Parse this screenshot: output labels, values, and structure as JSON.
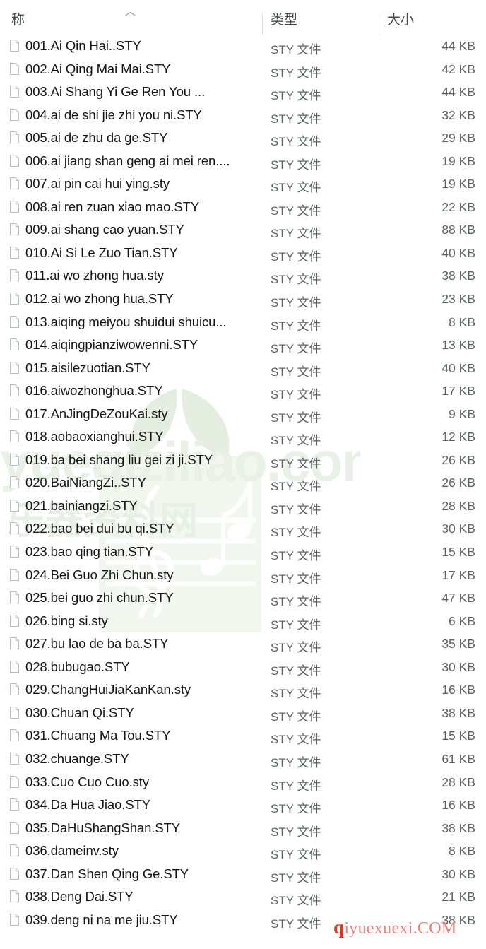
{
  "watermarks": {
    "green_text": "yueqiziliao.com",
    "green_subtext": "乐器资料网",
    "red_text": "qiyuexuexi.COM",
    "red_first_letter": "q",
    "red_rest": "iyuexuexi.COM",
    "red_color": "#d93b2b",
    "green_color": "#dfe9dc"
  },
  "columns": {
    "sort_indicator": "︿",
    "name_label": "名称",
    "name_label_clipped": "称",
    "type_label": "类型",
    "size_label": "大小"
  },
  "icon": {
    "file": "file-icon"
  },
  "files": [
    {
      "name": "001.Ai  Qin  Hai..STY",
      "type": "STY 文件",
      "size": "44 KB"
    },
    {
      "name": "002.Ai  Qing  Mai  Mai.STY",
      "type": "STY 文件",
      "size": "42 KB"
    },
    {
      "name": "003.Ai  Shang  Yi  Ge  Ren  You  ...",
      "type": "STY 文件",
      "size": "44 KB"
    },
    {
      "name": "004.ai de shi jie zhi you ni.STY",
      "type": "STY 文件",
      "size": "32 KB"
    },
    {
      "name": "005.ai de zhu da ge.STY",
      "type": "STY 文件",
      "size": "29 KB"
    },
    {
      "name": "006.ai jiang shan geng ai mei ren....",
      "type": "STY 文件",
      "size": "19 KB"
    },
    {
      "name": "007.ai pin cai hui ying.sty",
      "type": "STY 文件",
      "size": "19 KB"
    },
    {
      "name": "008.ai ren zuan xiao mao.STY",
      "type": "STY 文件",
      "size": "22 KB"
    },
    {
      "name": "009.ai shang cao yuan.STY",
      "type": "STY 文件",
      "size": "88 KB"
    },
    {
      "name": "010.Ai Si Le Zuo Tian.STY",
      "type": "STY 文件",
      "size": "40 KB"
    },
    {
      "name": "011.ai wo zhong hua.sty",
      "type": "STY 文件",
      "size": "38 KB"
    },
    {
      "name": "012.ai wo zhong hua.STY",
      "type": "STY 文件",
      "size": "23 KB"
    },
    {
      "name": "013.aiqing meiyou shuidui shuicu...",
      "type": "STY 文件",
      "size": "8 KB"
    },
    {
      "name": "014.aiqingpianziwowenni.STY",
      "type": "STY 文件",
      "size": "13 KB"
    },
    {
      "name": "015.aisilezuotian.STY",
      "type": "STY 文件",
      "size": "40 KB"
    },
    {
      "name": "016.aiwozhonghua.STY",
      "type": "STY 文件",
      "size": "17 KB"
    },
    {
      "name": "017.AnJingDeZouKai.sty",
      "type": "STY 文件",
      "size": "9 KB"
    },
    {
      "name": "018.aobaoxianghui.STY",
      "type": "STY 文件",
      "size": "12 KB"
    },
    {
      "name": "019.ba bei shang liu gei zi ji.STY",
      "type": "STY 文件",
      "size": "26 KB"
    },
    {
      "name": "020.BaiNiangZi..STY",
      "type": "STY 文件",
      "size": "26 KB"
    },
    {
      "name": "021.bainiangzi.STY",
      "type": "STY 文件",
      "size": "28 KB"
    },
    {
      "name": "022.bao bei dui bu qi.STY",
      "type": "STY 文件",
      "size": "30 KB"
    },
    {
      "name": "023.bao qing tian.STY",
      "type": "STY 文件",
      "size": "15 KB"
    },
    {
      "name": "024.Bei Guo Zhi Chun.sty",
      "type": "STY 文件",
      "size": "17 KB"
    },
    {
      "name": "025.bei guo zhi chun.STY",
      "type": "STY 文件",
      "size": "47 KB"
    },
    {
      "name": "026.bing si.sty",
      "type": "STY 文件",
      "size": "6 KB"
    },
    {
      "name": "027.bu lao de ba ba.STY",
      "type": "STY 文件",
      "size": "35 KB"
    },
    {
      "name": "028.bubugao.STY",
      "type": "STY 文件",
      "size": "30 KB"
    },
    {
      "name": "029.ChangHuiJiaKanKan.sty",
      "type": "STY 文件",
      "size": "16 KB"
    },
    {
      "name": "030.Chuan  Qi.STY",
      "type": "STY 文件",
      "size": "38 KB"
    },
    {
      "name": "031.Chuang Ma Tou.STY",
      "type": "STY 文件",
      "size": "15 KB"
    },
    {
      "name": "032.chuange.STY",
      "type": "STY 文件",
      "size": "61 KB"
    },
    {
      "name": "033.Cuo  Cuo  Cuo.sty",
      "type": "STY 文件",
      "size": "28 KB"
    },
    {
      "name": "034.Da  Hua  Jiao.STY",
      "type": "STY 文件",
      "size": "16 KB"
    },
    {
      "name": "035.DaHuShangShan.STY",
      "type": "STY 文件",
      "size": "38 KB"
    },
    {
      "name": "036.dameinv.sty",
      "type": "STY 文件",
      "size": "8 KB"
    },
    {
      "name": "037.Dan Shen Qing Ge.STY",
      "type": "STY 文件",
      "size": "30 KB"
    },
    {
      "name": "038.Deng  Dai.STY",
      "type": "STY 文件",
      "size": "21 KB"
    },
    {
      "name": "039.deng ni na me jiu.STY",
      "type": "STY 文件",
      "size": "38 KB"
    }
  ]
}
